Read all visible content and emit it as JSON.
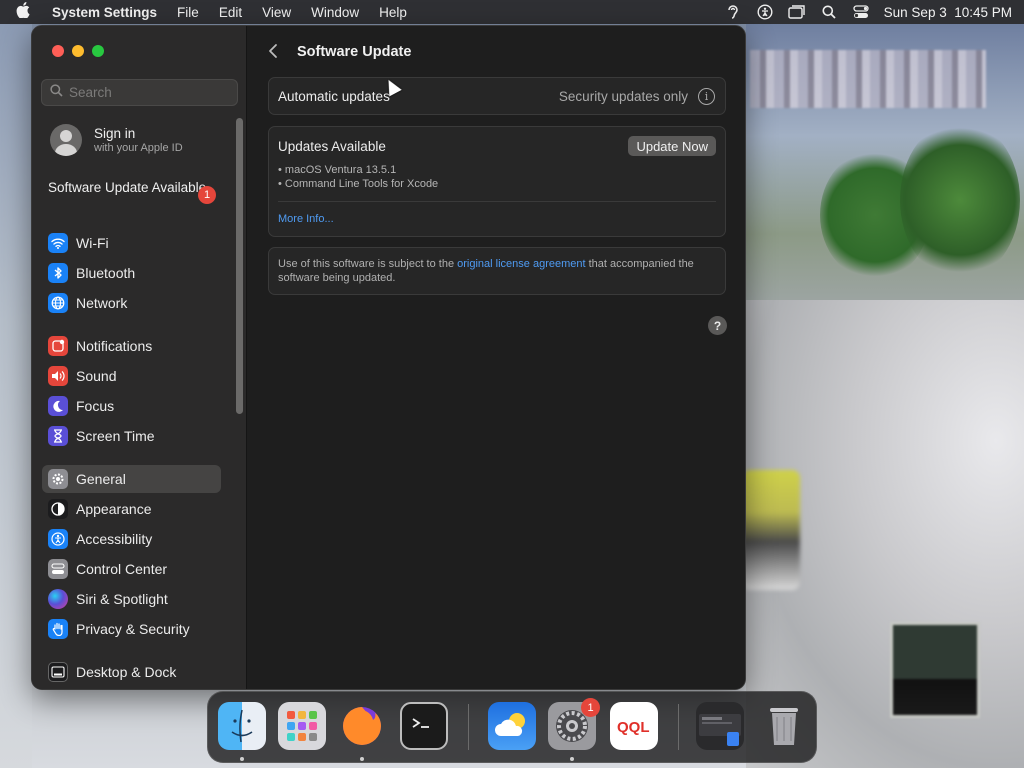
{
  "menubar": {
    "app_name": "System Settings",
    "items": [
      "File",
      "Edit",
      "View",
      "Window",
      "Help"
    ],
    "clock": "Sun Sep 3  10:45 PM"
  },
  "sidebar": {
    "search_placeholder": "Search",
    "signin_title": "Sign in",
    "signin_subtitle": "with your Apple ID",
    "software_update_label": "Software Update Available",
    "software_update_badge": "1",
    "items": [
      {
        "label": "Wi-Fi",
        "icon": "wifi-icon",
        "color": "#1a82f7"
      },
      {
        "label": "Bluetooth",
        "icon": "bluetooth-icon",
        "color": "#1a82f7"
      },
      {
        "label": "Network",
        "icon": "globe-icon",
        "color": "#1a82f7"
      },
      {
        "label": "Notifications",
        "icon": "bell-icon",
        "color": "#e5463b"
      },
      {
        "label": "Sound",
        "icon": "speaker-icon",
        "color": "#e5463b"
      },
      {
        "label": "Focus",
        "icon": "moon-icon",
        "color": "#5a4fd6"
      },
      {
        "label": "Screen Time",
        "icon": "hourglass-icon",
        "color": "#5a4fd6"
      },
      {
        "label": "General",
        "icon": "gear-icon",
        "color": "#8e8e93"
      },
      {
        "label": "Appearance",
        "icon": "appearance-icon",
        "color": "#1c1c1e"
      },
      {
        "label": "Accessibility",
        "icon": "accessibility-icon",
        "color": "#1a82f7"
      },
      {
        "label": "Control Center",
        "icon": "control-center-icon",
        "color": "#8e8e93"
      },
      {
        "label": "Siri & Spotlight",
        "icon": "siri-icon",
        "color": "#b442d9"
      },
      {
        "label": "Privacy & Security",
        "icon": "hand-icon",
        "color": "#1a82f7"
      },
      {
        "label": "Desktop & Dock",
        "icon": "dock-icon",
        "color": "#1c1c1e"
      }
    ],
    "selected": "General"
  },
  "content": {
    "title": "Software Update",
    "auto_updates_label": "Automatic updates",
    "auto_updates_value": "Security updates only",
    "updates_available_label": "Updates Available",
    "update_now_label": "Update Now",
    "updates": [
      "• macOS Ventura 13.5.1",
      "• Command Line Tools for Xcode"
    ],
    "more_info": "More Info...",
    "license_prefix": "Use of this software is subject to the ",
    "license_link": "original license agreement",
    "license_suffix": " that accompanied the software being updated.",
    "help_label": "?"
  },
  "dock": {
    "apps": [
      {
        "name": "Finder",
        "icon": "finder-icon"
      },
      {
        "name": "Launchpad",
        "icon": "launchpad-icon"
      },
      {
        "name": "Firefox",
        "icon": "firefox-icon"
      },
      {
        "name": "Terminal",
        "icon": "terminal-icon"
      },
      {
        "name": "Weather",
        "icon": "weather-icon"
      },
      {
        "name": "System Settings",
        "icon": "system-settings-icon",
        "badge": "1"
      },
      {
        "name": "QQL",
        "icon": "qql-icon"
      },
      {
        "name": "Downloads",
        "icon": "downloads-stack-icon"
      },
      {
        "name": "Trash",
        "icon": "trash-icon"
      }
    ]
  }
}
